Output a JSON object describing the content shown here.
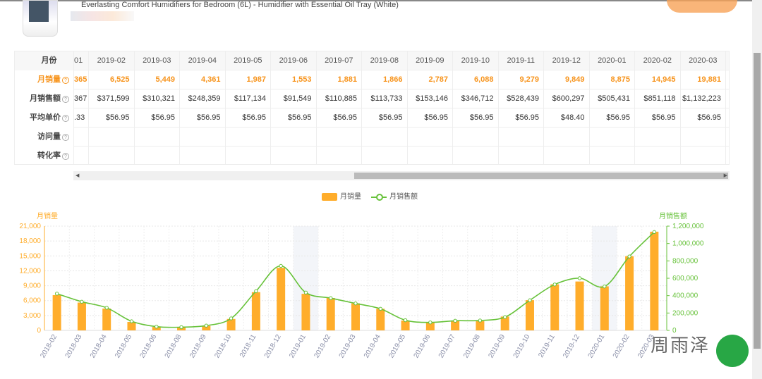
{
  "product": {
    "title": "Everlasting Comfort Humidifiers for Bedroom (6L) - Humidifier with Essential Oil Tray (White)"
  },
  "table": {
    "row_labels": [
      "月份",
      "月销量",
      "月销售额",
      "平均单价",
      "访问量",
      "转化率"
    ],
    "help_icon": "?",
    "partial_col": {
      "month": "01",
      "sales": "365",
      "revenue": "367",
      "price": ".33"
    },
    "months": [
      "2019-02",
      "2019-03",
      "2019-04",
      "2019-05",
      "2019-06",
      "2019-07",
      "2019-08",
      "2019-09",
      "2019-10",
      "2019-11",
      "2019-12",
      "2020-01",
      "2020-02",
      "2020-03"
    ],
    "sales": [
      "6,525",
      "5,449",
      "4,361",
      "1,987",
      "1,553",
      "1,881",
      "1,866",
      "2,787",
      "6,088",
      "9,279",
      "9,849",
      "8,875",
      "14,945",
      "19,881"
    ],
    "revenue": [
      "$371,599",
      "$310,321",
      "$248,359",
      "$117,134",
      "$91,549",
      "$110,885",
      "$113,733",
      "$153,146",
      "$346,712",
      "$528,439",
      "$600,297",
      "$505,431",
      "$851,118",
      "$1,132,223"
    ],
    "price": [
      "$56.95",
      "$56.95",
      "$56.95",
      "$56.95",
      "$56.95",
      "$56.95",
      "$56.95",
      "$56.95",
      "$56.95",
      "$56.95",
      "$48.40",
      "$56.95",
      "$56.95",
      "$56.95"
    ]
  },
  "watermark": "周雨泽",
  "chart_data": {
    "type": "bar+line",
    "legend": [
      "月销量",
      "月销售额"
    ],
    "ylabel_left": "月销量",
    "ylabel_right": "月销售额",
    "ylim_left": [
      0,
      21000
    ],
    "yticks_left": [
      "0",
      "3,000",
      "6,000",
      "9,000",
      "12,000",
      "15,000",
      "18,000",
      "21,000"
    ],
    "ylim_right": [
      0,
      1200000
    ],
    "yticks_right": [
      "0",
      "200,000",
      "400,000",
      "600,000",
      "800,000",
      "1,000,000",
      "1,200,000"
    ],
    "categories": [
      "2018-02",
      "2018-03",
      "2018-04",
      "2018-05",
      "2018-06",
      "2018-08",
      "2018-09",
      "2018-10",
      "2018-11",
      "2018-12",
      "2019-01",
      "2019-02",
      "2019-03",
      "2019-04",
      "2019-05",
      "2019-06",
      "2019-07",
      "2019-08",
      "2019-09",
      "2019-10",
      "2019-11",
      "2019-12",
      "2020-01",
      "2020-02",
      "2020-03"
    ],
    "series": [
      {
        "name": "月销量",
        "type": "bar",
        "axis": "left",
        "color": "#ffad2b",
        "values": [
          7100,
          5600,
          4400,
          1700,
          700,
          600,
          900,
          2300,
          7700,
          12600,
          7365,
          6525,
          5449,
          4361,
          1987,
          1553,
          1881,
          1866,
          2787,
          6088,
          9279,
          9849,
          8875,
          14945,
          19881
        ]
      },
      {
        "name": "月销售额",
        "type": "line",
        "axis": "right",
        "color": "#67c23a",
        "values": [
          423000,
          330000,
          260000,
          105000,
          43000,
          37000,
          55000,
          138000,
          452000,
          742000,
          435367,
          371599,
          310321,
          248359,
          117134,
          91549,
          110885,
          113733,
          153146,
          346712,
          528439,
          600297,
          505431,
          851118,
          1132223
        ]
      }
    ],
    "highlighted_categories": [
      "2019-01",
      "2020-01"
    ]
  }
}
